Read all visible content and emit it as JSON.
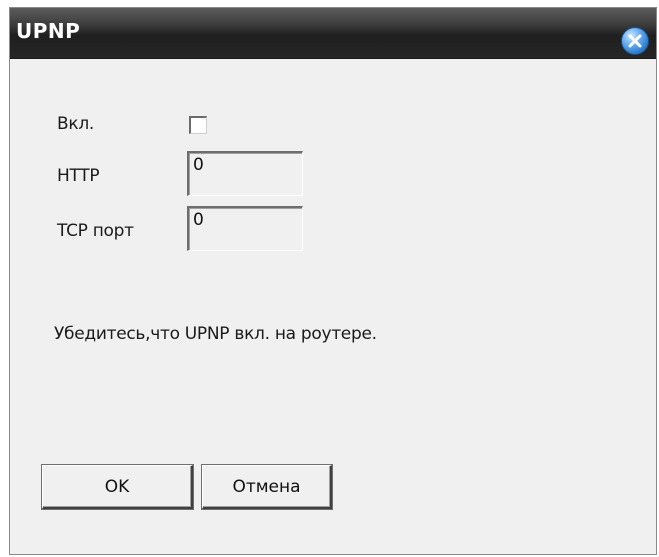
{
  "window": {
    "title": "UPNP",
    "close_icon": "close-icon"
  },
  "form": {
    "enable_label": "Вкл.",
    "enable_checked": false,
    "http_label": "HTTP",
    "http_value": "0",
    "tcp_label": "TCP порт",
    "tcp_value": "0",
    "hint": "Убедитесь,что UPNP вкл. на роутере."
  },
  "buttons": {
    "ok_label": "OK",
    "cancel_label": "Отмена"
  },
  "colors": {
    "titlebar": "#262626",
    "dialog_bg": "#f0f0f0",
    "close_button": "#2f7fd0"
  }
}
